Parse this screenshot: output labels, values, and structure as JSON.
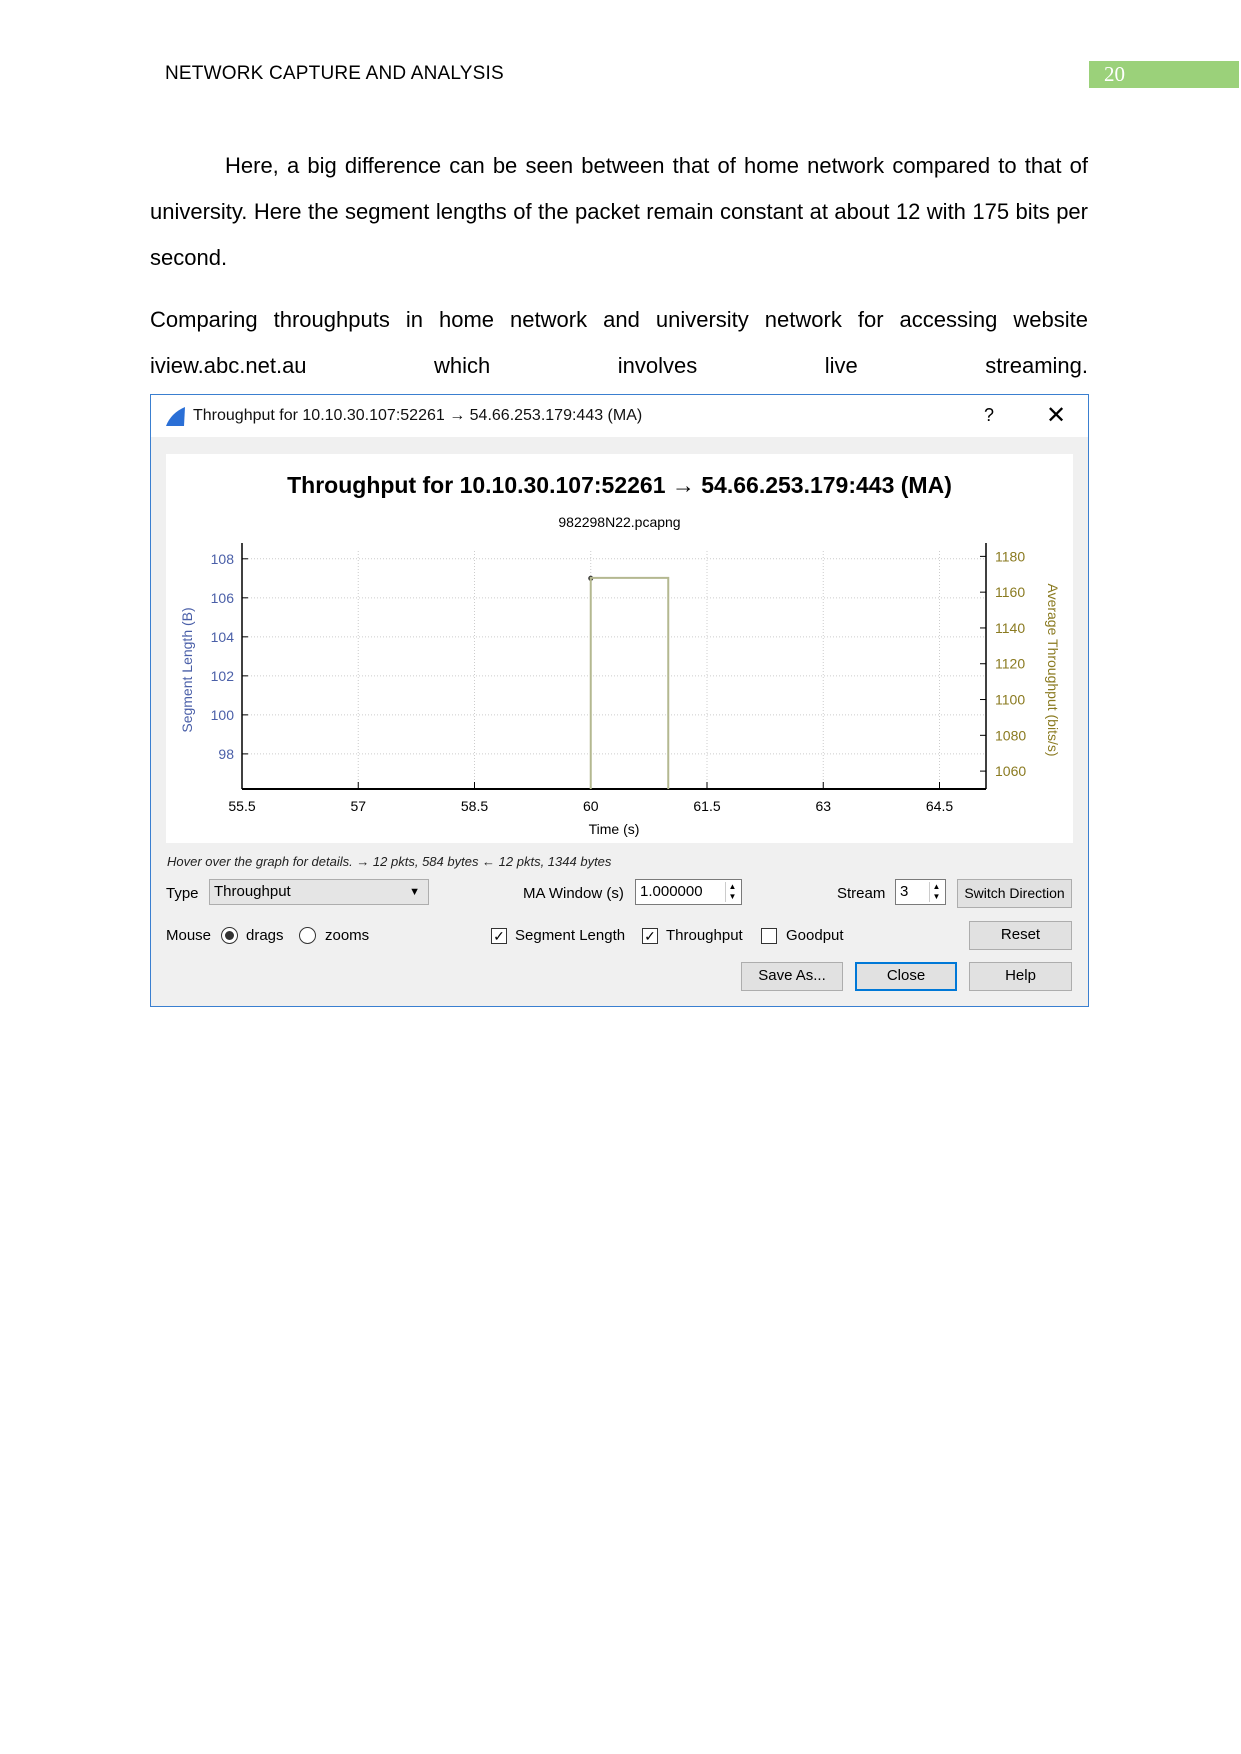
{
  "header": {
    "title": "NETWORK CAPTURE AND ANALYSIS",
    "page_number": "20",
    "page_number_bg": "#9bd17a"
  },
  "body": {
    "paragraph1": "Here, a big difference can be seen between that of home network compared to that of university. Here the segment lengths of the packet remain constant at about 12 with 175 bits per second.",
    "paragraph2": "Comparing throughputs in home network and university network for accessing website iview.abc.net.au which involves live streaming."
  },
  "dialog": {
    "window_title": "Throughput for 10.10.30.107:52261 → 54.66.253.179:443 (MA)",
    "help_label": "?",
    "close_label": "✕",
    "app_icon": "wireshark-fin-icon",
    "status_text": "Hover over the graph for details. → 12 pkts, 584 bytes ← 12 pkts, 1344 bytes",
    "type_label": "Type",
    "type_value": "Throughput",
    "ma_window_label": "MA Window (s)",
    "ma_window_value": "1.000000",
    "stream_label": "Stream",
    "stream_value": "3",
    "switch_direction_label": "Switch Direction",
    "mouse_label": "Mouse",
    "drags_label": "drags",
    "zooms_label": "zooms",
    "mouse_mode": "drags",
    "segment_length_label": "Segment Length",
    "segment_length_checked": true,
    "throughput_label": "Throughput",
    "throughput_checked": true,
    "goodput_label": "Goodput",
    "goodput_checked": false,
    "reset_label": "Reset",
    "save_as_label": "Save As...",
    "close_button_label": "Close",
    "help_button_label": "Help"
  },
  "chart_data": {
    "type": "line",
    "title": "Throughput for 10.10.30.107:52261 → 54.66.253.179:443 (MA)",
    "subtitle": "982298N22.pcapng",
    "xlabel": "Time (s)",
    "ylabel_left": "Segment Length (B)",
    "ylabel_right": "Average Throughput (bits/s)",
    "xlim": [
      55.5,
      65.1
    ],
    "ylim_left": [
      96.2,
      108.4
    ],
    "ylim_right": [
      1050,
      1183
    ],
    "xticks": [
      "55.5",
      "57",
      "58.5",
      "60",
      "61.5",
      "63",
      "64.5"
    ],
    "yticks_left": [
      "108",
      "106",
      "104",
      "102",
      "100",
      "98"
    ],
    "yticks_right": [
      "1180",
      "1160",
      "1140",
      "1120",
      "1100",
      "1080",
      "1060"
    ],
    "grid": true,
    "colors": {
      "left_axis": "#4a5fa8",
      "right_axis": "#8a7a20",
      "throughput_line": "#b4b890",
      "segment_point": "#333"
    },
    "series": [
      {
        "axis": "left",
        "kind": "scatter",
        "x": [
          60
        ],
        "y": [
          107
        ]
      },
      {
        "axis": "right",
        "kind": "step",
        "x": [
          60,
          60,
          61,
          61
        ],
        "y": [
          1050,
          1168,
          1168,
          1050
        ]
      }
    ]
  }
}
